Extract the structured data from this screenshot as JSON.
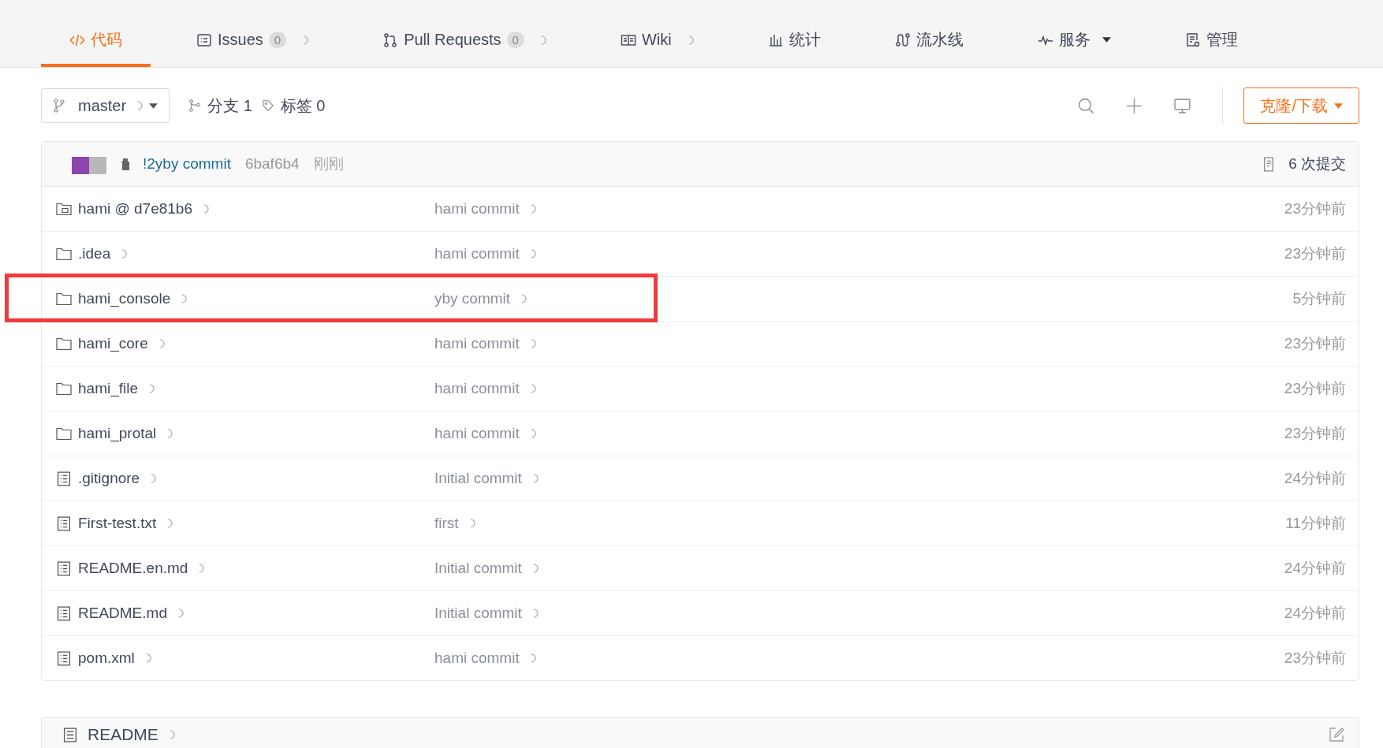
{
  "tabs": [
    {
      "label": "代码",
      "selected": true,
      "loading": false,
      "dropdown": false
    },
    {
      "label": "Issues",
      "count": "0",
      "selected": false,
      "loading": true,
      "dropdown": false
    },
    {
      "label": "Pull Requests",
      "count": "0",
      "selected": false,
      "loading": true,
      "dropdown": false
    },
    {
      "label": "Wiki",
      "selected": false,
      "loading": true,
      "dropdown": false
    },
    {
      "label": "统计",
      "selected": false,
      "loading": false,
      "dropdown": false
    },
    {
      "label": "流水线",
      "selected": false,
      "loading": false,
      "dropdown": false
    },
    {
      "label": "服务",
      "selected": false,
      "loading": false,
      "dropdown": true
    },
    {
      "label": "管理",
      "selected": false,
      "loading": false,
      "dropdown": false
    }
  ],
  "toolbar": {
    "branch": "master",
    "branches": "分支 1",
    "tags": "标签 0",
    "clone_button": "克隆/下载"
  },
  "latest_commit": {
    "message": "!2yby commit",
    "hash": "6baf6b4",
    "time": "刚刚",
    "commit_count": "6 次提交"
  },
  "files": [
    {
      "kind": "submodule",
      "name": "hami @ d7e81b6",
      "message": "hami commit",
      "time": "23分钟前",
      "highlighted": false
    },
    {
      "kind": "folder",
      "name": ".idea",
      "message": "hami commit",
      "time": "23分钟前",
      "highlighted": false
    },
    {
      "kind": "folder",
      "name": "hami_console",
      "message": "yby commit",
      "time": "5分钟前",
      "highlighted": true
    },
    {
      "kind": "folder",
      "name": "hami_core",
      "message": "hami commit",
      "time": "23分钟前",
      "highlighted": false
    },
    {
      "kind": "folder",
      "name": "hami_file",
      "message": "hami commit",
      "time": "23分钟前",
      "highlighted": false
    },
    {
      "kind": "folder",
      "name": "hami_protal",
      "message": "hami commit",
      "time": "23分钟前",
      "highlighted": false
    },
    {
      "kind": "file",
      "name": ".gitignore",
      "message": "Initial commit",
      "time": "24分钟前",
      "highlighted": false
    },
    {
      "kind": "file",
      "name": "First-test.txt",
      "message": "first",
      "time": "11分钟前",
      "highlighted": false
    },
    {
      "kind": "file",
      "name": "README.en.md",
      "message": "Initial commit",
      "time": "24分钟前",
      "highlighted": false
    },
    {
      "kind": "file",
      "name": "README.md",
      "message": "Initial commit",
      "time": "24分钟前",
      "highlighted": false
    },
    {
      "kind": "file",
      "name": "pom.xml",
      "message": "hami commit",
      "time": "23分钟前",
      "highlighted": false
    }
  ],
  "readme": {
    "title": "README"
  }
}
